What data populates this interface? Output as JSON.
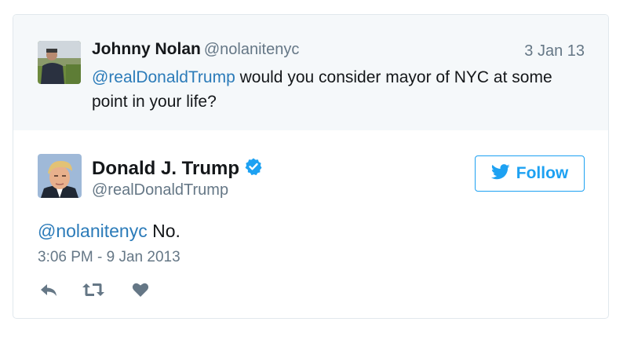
{
  "parent_tweet": {
    "author_name": "Johnny Nolan",
    "author_handle": "@nolanitenyc",
    "date": "3 Jan 13",
    "mention": "@realDonaldTrump",
    "text": " would you consider mayor of NYC at some point in your life?"
  },
  "main_tweet": {
    "author_name": "Donald J. Trump",
    "author_handle": "@realDonaldTrump",
    "verified": true,
    "mention": "@nolanitenyc",
    "text": " No.",
    "timestamp": "3:06 PM - 9 Jan 2013"
  },
  "follow_button": {
    "label": "Follow",
    "icon": "twitter-bird-icon"
  },
  "actions": [
    {
      "name": "reply",
      "icon": "reply-icon"
    },
    {
      "name": "retweet",
      "icon": "retweet-icon"
    },
    {
      "name": "like",
      "icon": "heart-icon"
    }
  ],
  "colors": {
    "link": "#2b7bb9",
    "twitter_blue": "#1da1f2",
    "muted": "#657786",
    "parent_bg": "#f5f8fa"
  }
}
